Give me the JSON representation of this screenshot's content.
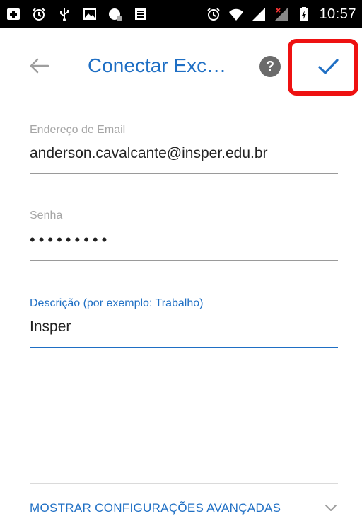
{
  "status_bar": {
    "time": "10:57",
    "icons": [
      "notification-icon",
      "alarm-icon",
      "usb-icon",
      "image-icon",
      "spy-icon",
      "keyboard-icon",
      "alarm-icon",
      "wifi-icon",
      "signal-icon",
      "no-signal-icon",
      "battery-charging-icon"
    ]
  },
  "app_bar": {
    "title": "Conectar Exc…",
    "back_icon": "arrow-back-icon",
    "help_icon": "help-icon",
    "help_label": "?",
    "confirm_icon": "check-icon"
  },
  "form": {
    "email": {
      "label": "Endereço de Email",
      "value": "anderson.cavalcante@insper.edu.br"
    },
    "password": {
      "label": "Senha",
      "value": "•••••••••"
    },
    "description": {
      "label": "Descrição (por exemplo: Trabalho)",
      "value": "Insper"
    }
  },
  "advanced": {
    "label": "MOSTRAR CONFIGURAÇÕES AVANÇADAS",
    "icon": "chevron-down-icon"
  },
  "colors": {
    "accent": "#1f6fc4",
    "highlight": "#ee1111",
    "status_bar": "#000000"
  }
}
